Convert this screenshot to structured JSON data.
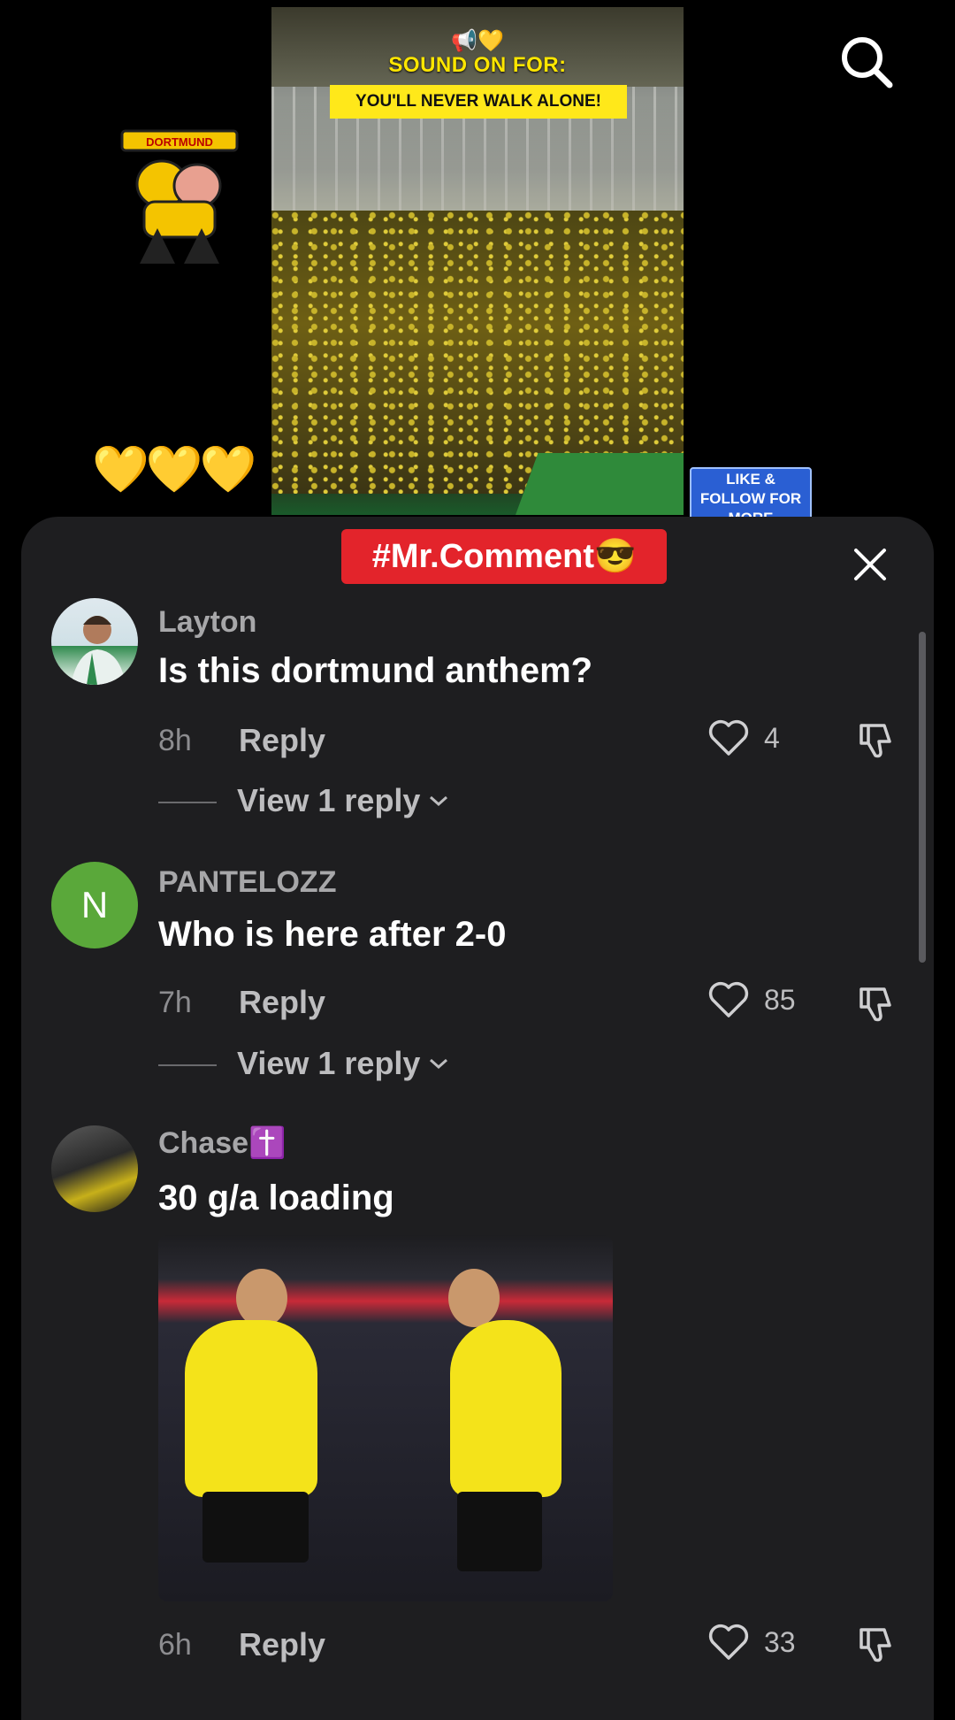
{
  "video": {
    "title": "SOUND ON FOR:",
    "banner": "YOU'LL NEVER WALK ALONE!",
    "icons": "📢💛",
    "sticker_label": "DORTMUND",
    "hearts": "💛💛💛",
    "like_follow": "LIKE & FOLLOW FOR MORE"
  },
  "sheet": {
    "tag": "#Mr.Comment😎"
  },
  "comments": [
    {
      "username": "Layton",
      "text": "Is this dortmund anthem?",
      "time": "8h",
      "reply_label": "Reply",
      "likes": "4",
      "view_replies": "View 1 reply"
    },
    {
      "username": "PANTELOZZ",
      "avatar_letter": "N",
      "text": "Who is here after 2-0",
      "time": "7h",
      "reply_label": "Reply",
      "likes": "85",
      "view_replies": "View 1 reply"
    },
    {
      "username": "Chase✝️",
      "text": "30 g/a loading",
      "time": "6h",
      "reply_label": "Reply",
      "likes": "33"
    }
  ],
  "colors": {
    "sheet_bg": "#1e1e20",
    "tag_bg": "#e3242b",
    "avatar_green": "#5aa83a",
    "bvb_yellow": "#f4e31a"
  }
}
